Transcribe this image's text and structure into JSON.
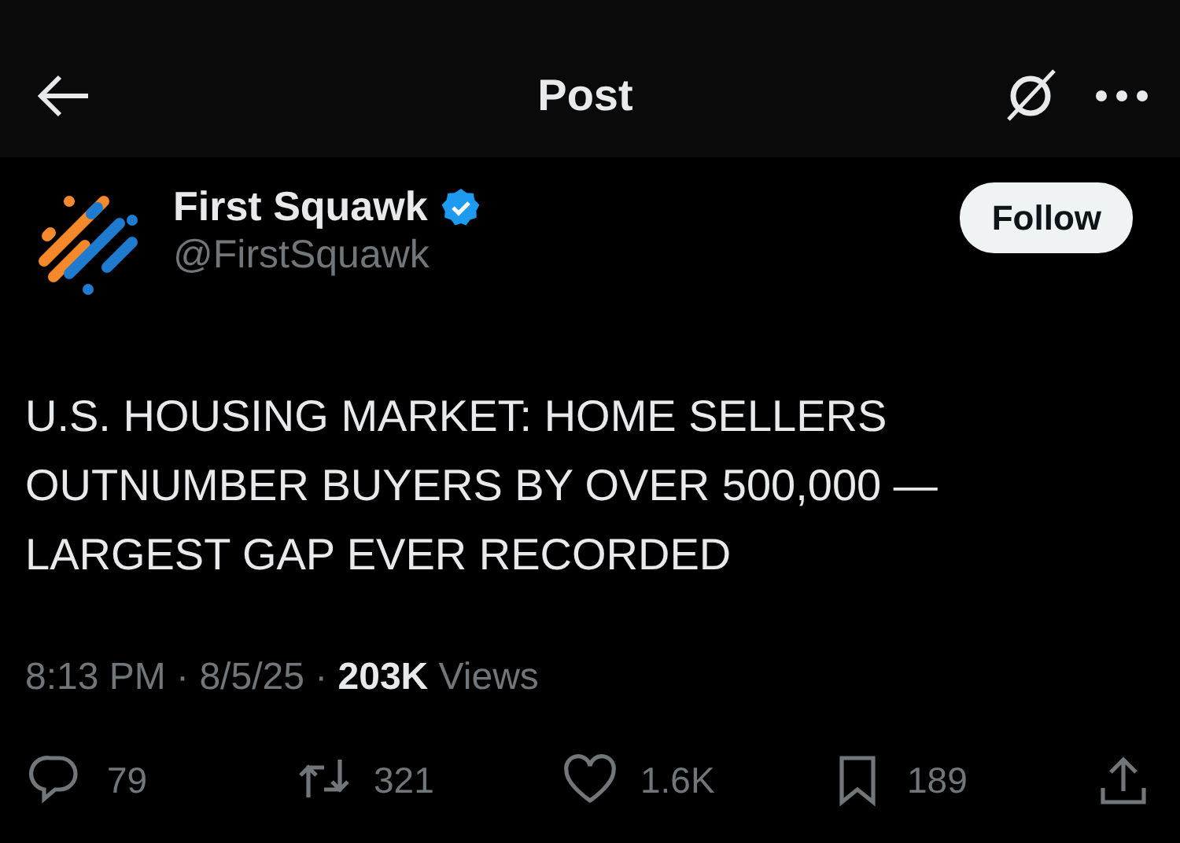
{
  "header": {
    "title": "Post"
  },
  "author": {
    "name": "First Squawk",
    "verified": true,
    "handle": "@FirstSquawk",
    "follow_label": "Follow"
  },
  "post": {
    "text": "U.S. HOUSING MARKET: HOME SELLERS OUTNUMBER BUYERS BY OVER 500,000 — LARGEST GAP EVER RECORDED",
    "meta": "8:13 PM · 8/5/25 · **203K** Views"
  },
  "actions": [
    {
      "kind": "reply",
      "count": "79"
    },
    {
      "kind": "repost",
      "count": "321"
    },
    {
      "kind": "like",
      "count": "1.6K"
    },
    {
      "kind": "bookmark",
      "count": "189"
    },
    {
      "kind": "share"
    }
  ]
}
